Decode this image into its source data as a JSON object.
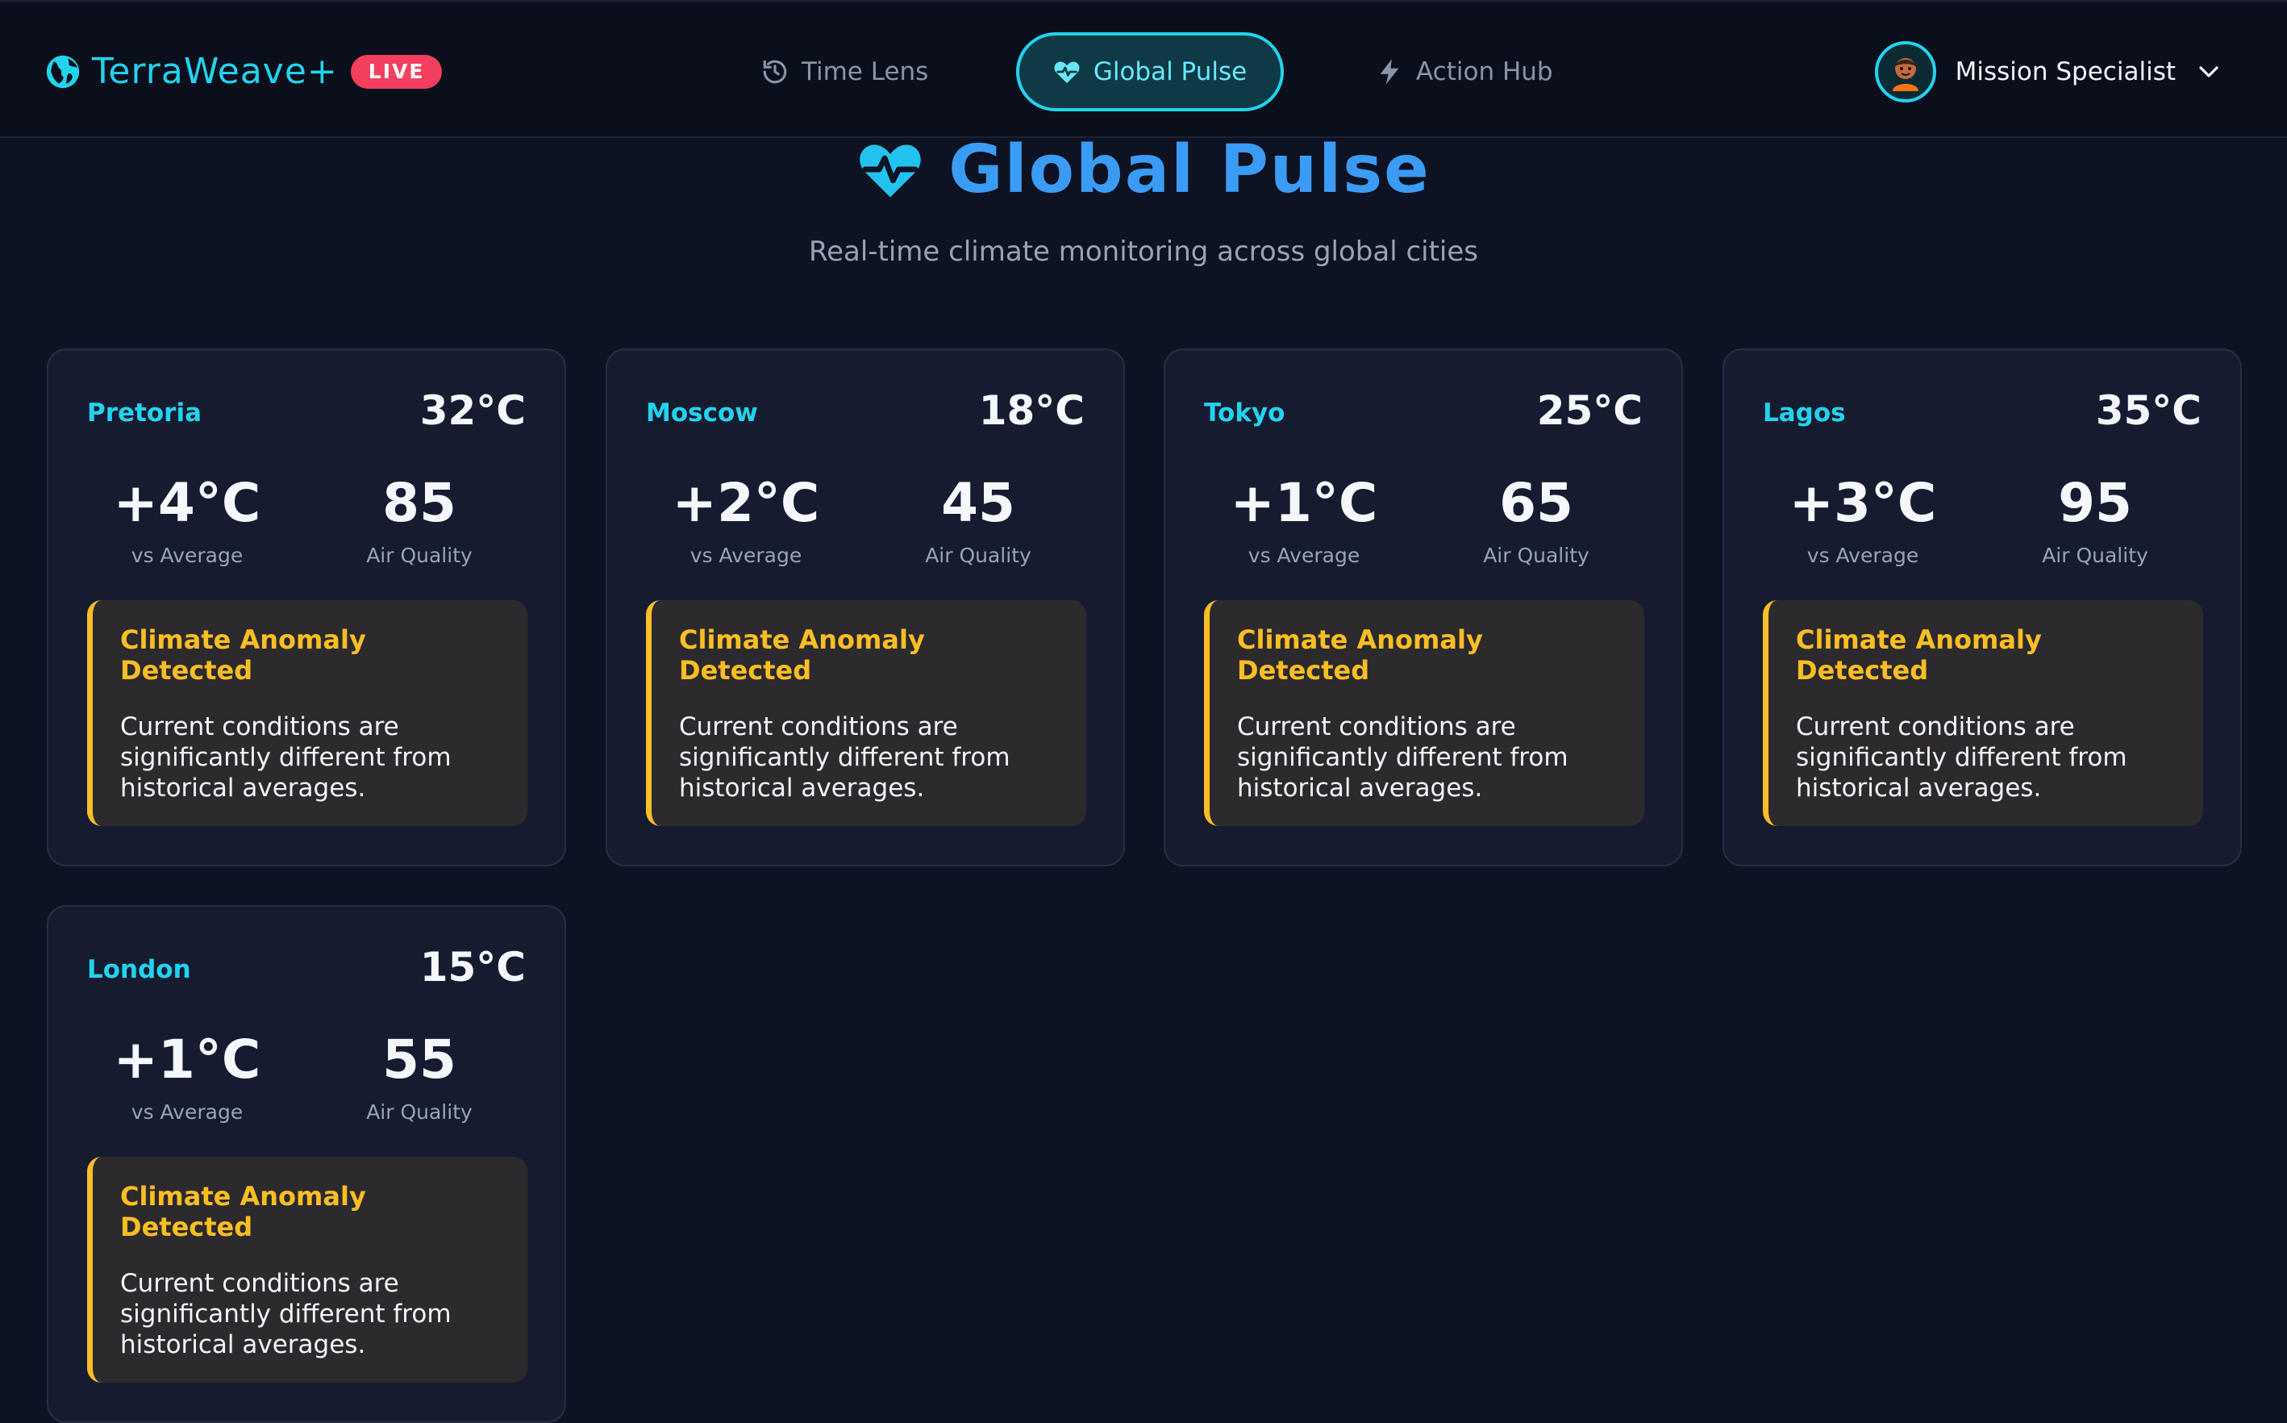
{
  "header": {
    "brand": "TerraWeave+",
    "badge": "LIVE",
    "nav": [
      {
        "label": "Time Lens",
        "icon": "history-icon"
      },
      {
        "label": "Global Pulse",
        "icon": "heart-pulse-icon",
        "active": true
      },
      {
        "label": "Action Hub",
        "icon": "lightning-icon"
      }
    ],
    "user": {
      "name": "Mission Specialist",
      "icon": "chevron-down-icon"
    }
  },
  "hero": {
    "title": "Global Pulse",
    "subtitle": "Real-time climate monitoring across global cities"
  },
  "cards": [
    {
      "city": "Pretoria",
      "temp": "32°C",
      "delta": "+4°C",
      "delta_label": "vs Average",
      "aqi": "85",
      "aqi_label": "Air Quality",
      "alert_title": "Climate Anomaly Detected",
      "alert_body": "Current conditions are significantly different from historical averages."
    },
    {
      "city": "Moscow",
      "temp": "18°C",
      "delta": "+2°C",
      "delta_label": "vs Average",
      "aqi": "45",
      "aqi_label": "Air Quality",
      "alert_title": "Climate Anomaly Detected",
      "alert_body": "Current conditions are significantly different from historical averages."
    },
    {
      "city": "Tokyo",
      "temp": "25°C",
      "delta": "+1°C",
      "delta_label": "vs Average",
      "aqi": "65",
      "aqi_label": "Air Quality",
      "alert_title": "Climate Anomaly Detected",
      "alert_body": "Current conditions are significantly different from historical averages."
    },
    {
      "city": "Lagos",
      "temp": "35°C",
      "delta": "+3°C",
      "delta_label": "vs Average",
      "aqi": "95",
      "aqi_label": "Air Quality",
      "alert_title": "Climate Anomaly Detected",
      "alert_body": "Current conditions are significantly different from historical averages."
    },
    {
      "city": "London",
      "temp": "15°C",
      "delta": "+1°C",
      "delta_label": "vs Average",
      "aqi": "55",
      "aqi_label": "Air Quality",
      "alert_title": "Climate Anomaly Detected",
      "alert_body": "Current conditions are significantly different from historical averages."
    }
  ],
  "colors": {
    "accent": "#22d3ee",
    "hero_title": "#3b9cf5",
    "live_badge": "#f43f5e",
    "alert": "#fbbf24",
    "background": "#0e1323",
    "card": "#161c30"
  }
}
